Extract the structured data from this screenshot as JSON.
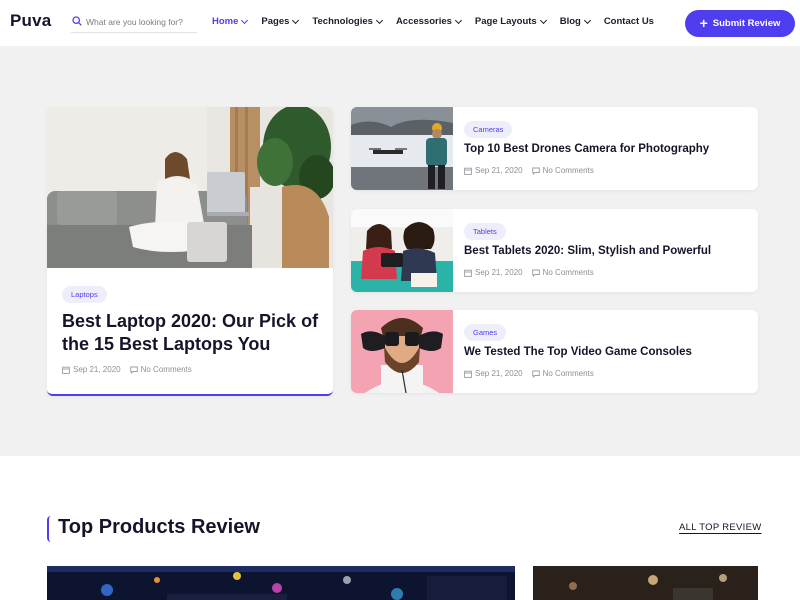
{
  "header": {
    "logo": "Puva",
    "search_placeholder": "What are you looking for?",
    "nav": [
      {
        "label": "Home",
        "active": true,
        "dropdown": true
      },
      {
        "label": "Pages",
        "dropdown": true
      },
      {
        "label": "Technologies",
        "dropdown": true
      },
      {
        "label": "Accessories",
        "dropdown": true
      },
      {
        "label": "Page Layouts",
        "dropdown": true
      },
      {
        "label": "Blog",
        "dropdown": true
      },
      {
        "label": "Contact Us",
        "dropdown": false
      }
    ],
    "submit_label": "Submit Review"
  },
  "colors": {
    "accent": "#4f3df0",
    "hero_bg": "#f1f1f1",
    "tag_bg": "#eeeefb"
  },
  "featured": {
    "tag": "Laptops",
    "title": "Best Laptop 2020: Our Pick of the 15 Best Laptops You",
    "date": "Sep 21, 2020",
    "comments": "No Comments"
  },
  "posts": [
    {
      "tag": "Cameras",
      "title": "Top 10 Best Drones Camera for Photography",
      "date": "Sep 21, 2020",
      "comments": "No Comments"
    },
    {
      "tag": "Tablets",
      "title": "Best Tablets 2020: Slim, Stylish and Powerful",
      "date": "Sep 21, 2020",
      "comments": "No Comments"
    },
    {
      "tag": "Games",
      "title": "We Tested The Top Video Game Consoles",
      "date": "Sep 21, 2020",
      "comments": "No Comments"
    }
  ],
  "section": {
    "title": "Top Products Review",
    "all_link": "ALL TOP REVIEW"
  }
}
